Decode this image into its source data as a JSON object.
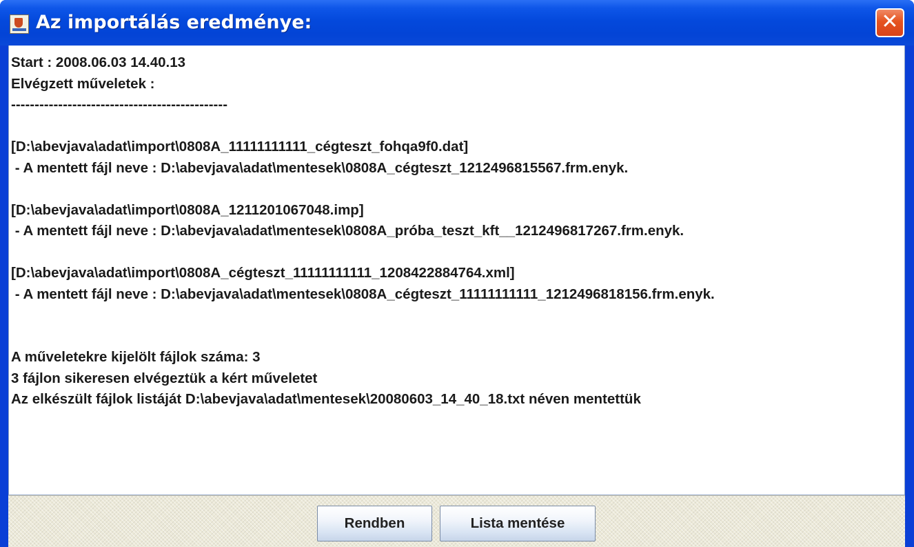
{
  "window": {
    "title": "Az importálás eredménye:",
    "close_label": "✕"
  },
  "log": {
    "lines": [
      "Start : 2008.06.03 14.40.13",
      "Elvégzett műveletek :",
      "----------------------------------------------",
      "",
      "[D:\\abevjava\\adat\\import\\0808A_11111111111_cégteszt_fohqa9f0.dat]",
      " - A mentett fájl neve : D:\\abevjava\\adat\\mentesek\\0808A_cégteszt_1212496815567.frm.enyk.",
      "",
      "[D:\\abevjava\\adat\\import\\0808A_1211201067048.imp]",
      " - A mentett fájl neve : D:\\abevjava\\adat\\mentesek\\0808A_próba_teszt_kft__1212496817267.frm.enyk.",
      "",
      "[D:\\abevjava\\adat\\import\\0808A_cégteszt_11111111111_1208422884764.xml]",
      " - A mentett fájl neve : D:\\abevjava\\adat\\mentesek\\0808A_cégteszt_11111111111_1212496818156.frm.enyk.",
      "",
      "",
      "A műveletekre kijelölt fájlok száma: 3",
      "3 fájlon sikeresen elvégeztük a kért műveletet",
      "Az elkészült fájlok listáját D:\\abevjava\\adat\\mentesek\\20080603_14_40_18.txt néven mentettük"
    ]
  },
  "buttons": {
    "ok_label": "Rendben",
    "save_list_label": "Lista mentése"
  }
}
